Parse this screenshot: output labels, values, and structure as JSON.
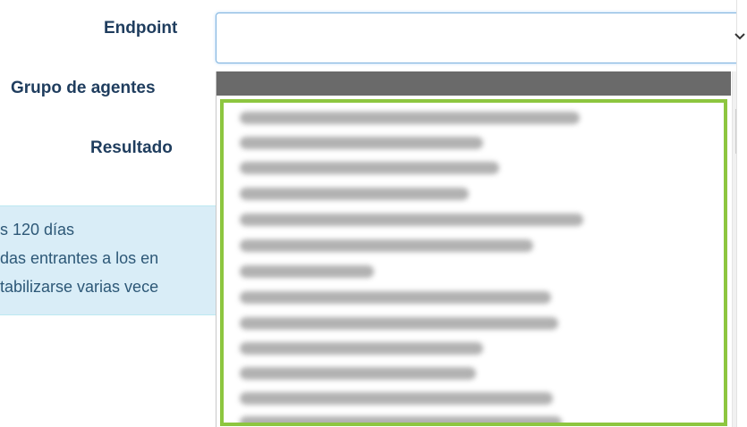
{
  "form": {
    "endpoint_label": "Endpoint",
    "agent_group_label": "Grupo de agentes",
    "result_label": "Resultado"
  },
  "endpoint_select": {
    "value": "",
    "chevron_icon": "chevron-down-icon"
  },
  "info": {
    "line1": "s 120 días",
    "line2": "das entrantes a los en",
    "line3": "tabilizarse varias vece"
  },
  "dropdown": {
    "highlight_color": "#8dc63f",
    "items_count_visible": 13
  }
}
